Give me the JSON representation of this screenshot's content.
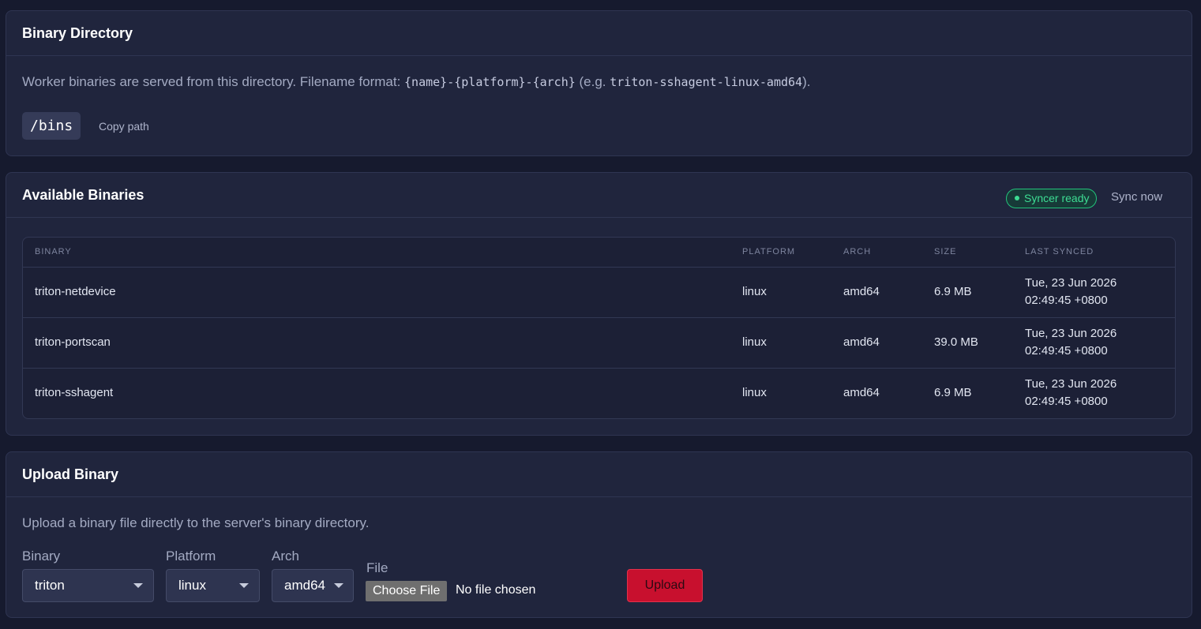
{
  "directory": {
    "title": "Binary Directory",
    "desc_prefix": "Worker binaries are served from this directory. Filename format: ",
    "format_pattern": "{name}-{platform}-{arch}",
    "desc_eg_prefix": " (e.g. ",
    "example_name": "triton-sshagent-linux-amd64",
    "desc_suffix": ").",
    "path": "/bins",
    "copy_label": "Copy path"
  },
  "binaries": {
    "title": "Available Binaries",
    "status_badge": "Syncer ready",
    "status_color": "#3ddc93",
    "sync_label": "Sync now",
    "columns": [
      "BINARY",
      "PLATFORM",
      "ARCH",
      "SIZE",
      "LAST SYNCED"
    ],
    "rows": [
      {
        "name": "triton-netdevice",
        "platform": "linux",
        "arch": "amd64",
        "size": "6.9 MB",
        "synced_date": "Tue, 23 Jun 2026",
        "synced_time": "02:49:45 +0800"
      },
      {
        "name": "triton-portscan",
        "platform": "linux",
        "arch": "amd64",
        "size": "39.0 MB",
        "synced_date": "Tue, 23 Jun 2026",
        "synced_time": "02:49:45 +0800"
      },
      {
        "name": "triton-sshagent",
        "platform": "linux",
        "arch": "amd64",
        "size": "6.9 MB",
        "synced_date": "Tue, 23 Jun 2026",
        "synced_time": "02:49:45 +0800"
      }
    ]
  },
  "upload": {
    "title": "Upload Binary",
    "description": "Upload a binary file directly to the server's binary directory.",
    "binary_label": "Binary",
    "binary_value": "triton",
    "platform_label": "Platform",
    "platform_value": "linux",
    "arch_label": "Arch",
    "arch_value": "amd64",
    "file_label": "File",
    "choose_file_label": "Choose File",
    "file_status": "No file chosen",
    "upload_label": "Upload",
    "accent_color": "#c8102e"
  }
}
